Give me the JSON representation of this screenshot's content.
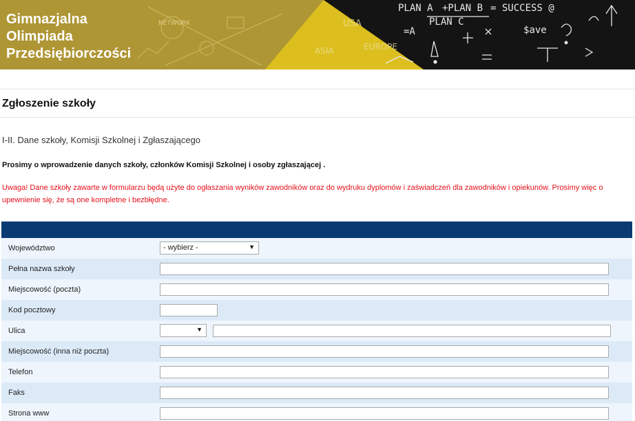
{
  "banner": {
    "title_lines": [
      "Gimnazjalna",
      "Olimpiada",
      "Przedsiębiorczości"
    ],
    "chalk_texts": [
      "PLAN A",
      "+PLAN B",
      "= SUCCESS @",
      "PLAN C",
      "$ave",
      "=A",
      "USA",
      "ASIA",
      "EUROPE",
      "NETWORK"
    ],
    "colors": {
      "gold": "#c9ab26",
      "chalkboard": "#141414",
      "header_bar": "#0b3a72",
      "warning": "#e3101a"
    }
  },
  "page_title": "Zgłoszenie szkoły",
  "section_title": "I-II. Dane szkoły, Komisji Szkolnej i Zgłaszającego",
  "intro_text": "Prosimy o wprowadzenie danych szkoły, członków Komisji Szkolnej i osoby zgłaszającej .",
  "warning_text": "Uwaga! Dane szkoły zawarte w formularzu będą użyte do ogłaszania wyników zawodników oraz do wydruku dyplomów i zaświadczeń dla zawodników i opiekunów. Prosimy więc o upewnienie się, że są one kompletne i bezbłędne.",
  "form": {
    "wojewodztwo_label": "Województwo",
    "wojewodztwo_value": "- wybierz -",
    "pelna_nazwa_label": "Pełna nazwa szkoły",
    "miejscowosc_poczta_label": "Miejscowość (poczta)",
    "kod_pocztowy_label": "Kod pocztowy",
    "ulica_label": "Ulica",
    "ulica_prefix_value": "",
    "miejscowosc_inna_label": "Miejscowość (inna niż poczta)",
    "telefon_label": "Telefon",
    "faks_label": "Faks",
    "strona_www_label": "Strona www",
    "dropdown_arrow": "▼"
  }
}
